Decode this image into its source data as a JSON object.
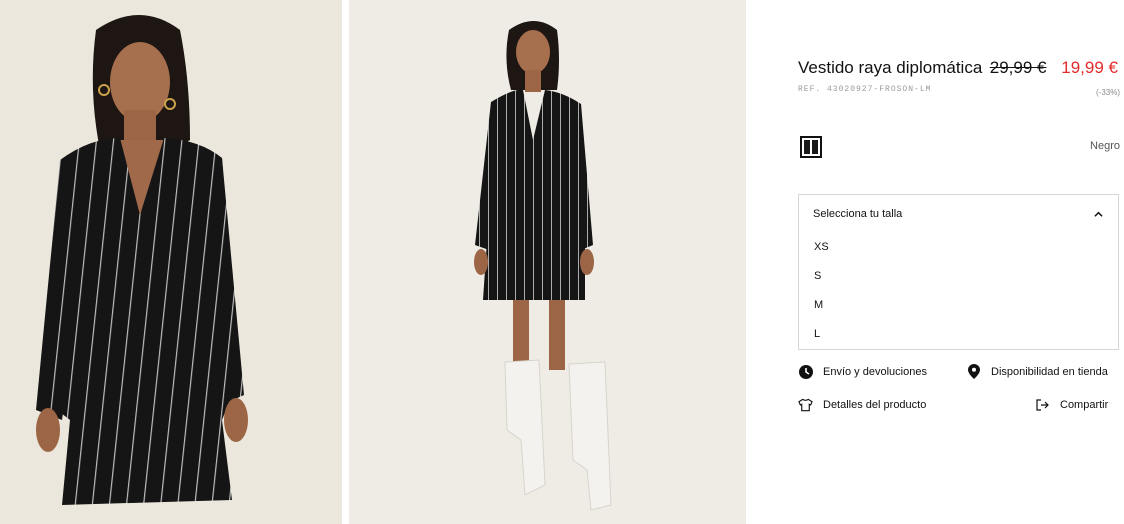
{
  "product": {
    "title": "Vestido raya diplomática",
    "old_price": "29,99 €",
    "new_price": "19,99 €",
    "ref": "REF. 43020927-FROSON-LM",
    "discount": "(-33%)"
  },
  "color": {
    "name": "Negro"
  },
  "sizes": {
    "header": "Selecciona tu talla",
    "options": [
      "XS",
      "S",
      "M",
      "L"
    ]
  },
  "links": {
    "shipping": "Envío y devoluciones",
    "store_availability": "Disponibilidad en tienda",
    "details": "Detalles del producto",
    "share": "Compartir"
  },
  "colors": {
    "price_red": "#e22b2b",
    "border": "#d6d6d6"
  },
  "icons": {
    "shipping": "clock-icon",
    "store_availability": "location-pin-icon",
    "details": "tshirt-icon",
    "share": "share-icon"
  }
}
